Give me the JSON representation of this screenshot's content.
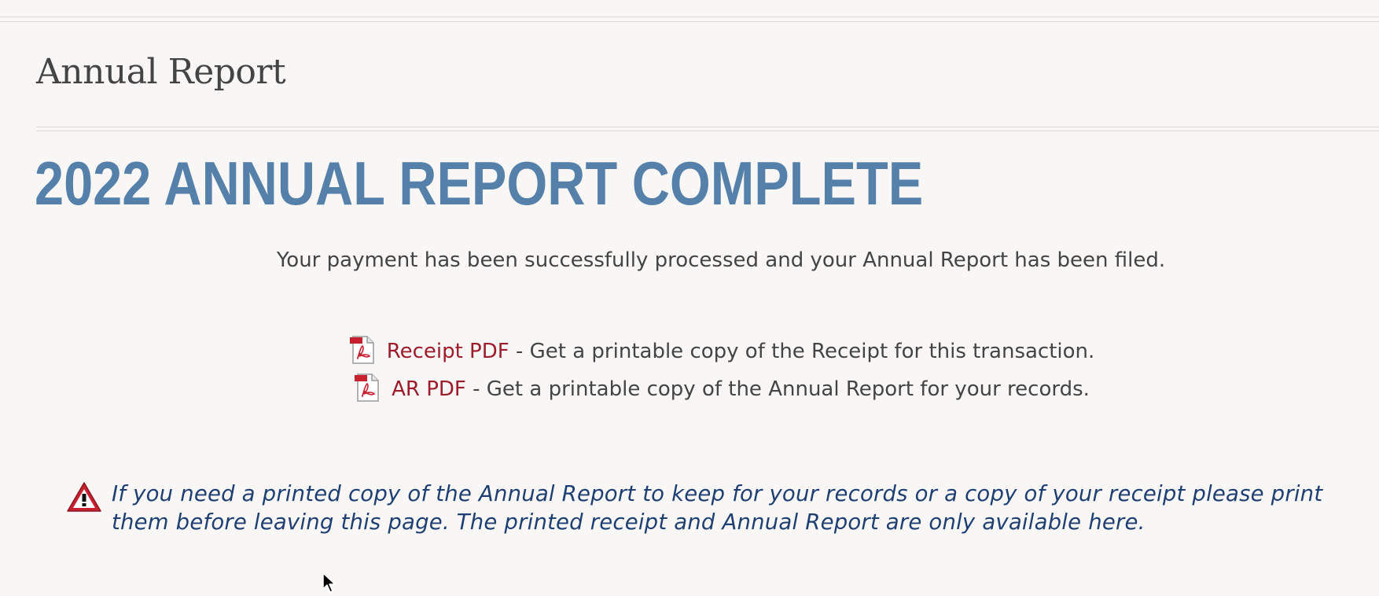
{
  "page": {
    "section_title": "Annual Report",
    "headline": "2022 ANNUAL REPORT COMPLETE",
    "success_message": "Your payment has been successfully processed and your Annual Report has been filed."
  },
  "downloads": [
    {
      "icon": "pdf-icon",
      "link_label": "Receipt PDF",
      "description": " - Get a printable copy of the Receipt for this transaction."
    },
    {
      "icon": "pdf-icon",
      "link_label": "AR PDF",
      "description": " - Get a printable copy of the Annual Report for your records."
    }
  ],
  "notice": {
    "icon": "warning-icon",
    "text": "If you need a printed copy of the Annual Report to keep for your records or a copy of your receipt please print them before leaving this page. The printed receipt and Annual Report are only available here."
  },
  "colors": {
    "background": "#f8f7f6",
    "headline": "#5580aa",
    "link": "#9e1b2b",
    "notice_text": "#1f3f73",
    "body_text": "#444444"
  }
}
